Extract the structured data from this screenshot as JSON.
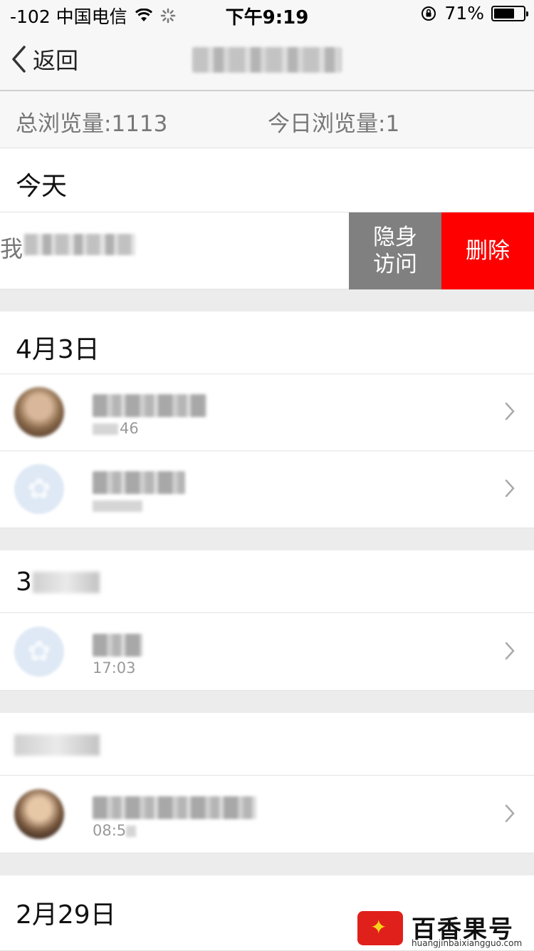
{
  "status_bar": {
    "carrier": "-102 中国电信",
    "time": "下午9:19",
    "battery": "71%",
    "battery_level": 0.71
  },
  "nav": {
    "back_label": "返回"
  },
  "stats": {
    "total_views": "总浏览量:1113",
    "today_views": "今日浏览量:1"
  },
  "sections": {
    "today": {
      "label": "今天"
    },
    "apr3": {
      "label": "4月3日"
    },
    "mar29": {
      "label": "3"
    },
    "mar_blur": {
      "label": ""
    },
    "feb29": {
      "label": "2月29日"
    }
  },
  "swipe_row": {
    "text": "我",
    "hide_label_line1": "隐身",
    "hide_label_line2": "访问",
    "delete_label": "删除"
  },
  "rows": [
    {
      "time": "46"
    },
    {
      "time": ""
    },
    {
      "time": "17:03"
    },
    {
      "time": "08:5"
    }
  ],
  "watermark": {
    "brand": "百香果号",
    "url": "huangjinbaixiangguo.com"
  },
  "icons": [
    "back-chevron-icon",
    "wifi-icon",
    "loading-spinner-icon",
    "rotation-lock-icon",
    "battery-icon",
    "chevron-right-icon"
  ]
}
